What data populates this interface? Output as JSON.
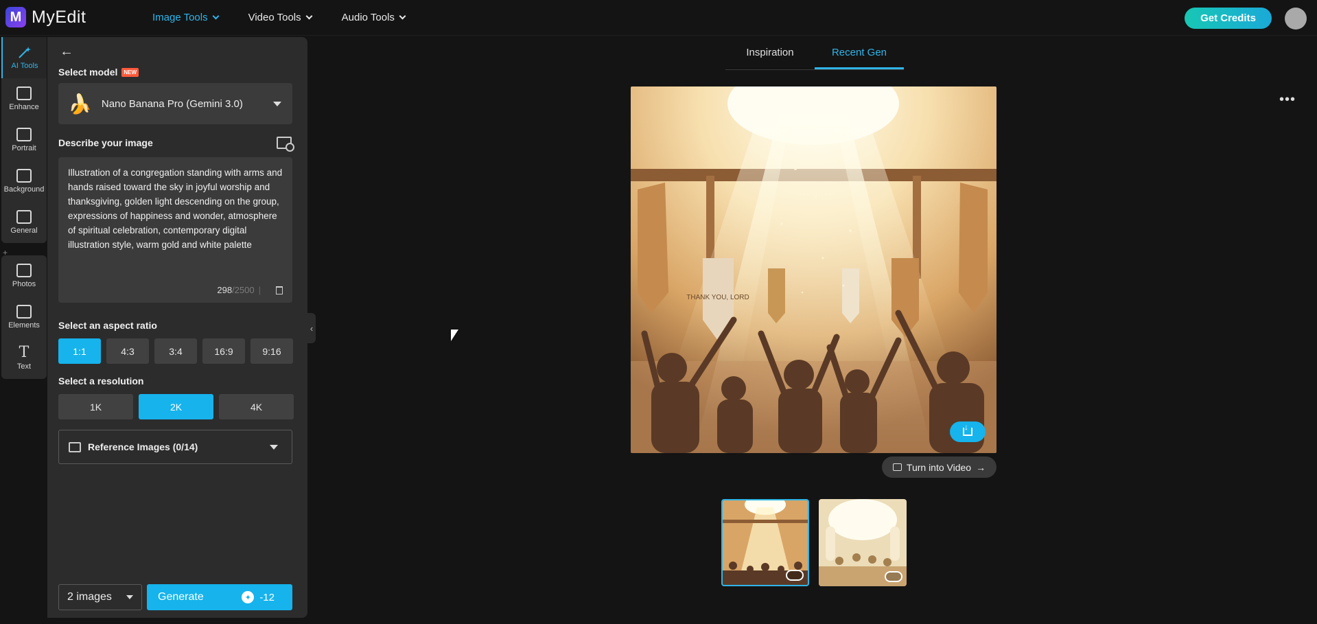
{
  "app": {
    "name": "MyEdit",
    "logo_letter": "M"
  },
  "topnav": [
    {
      "label": "Image Tools",
      "active": true
    },
    {
      "label": "Video Tools",
      "active": false
    },
    {
      "label": "Audio Tools",
      "active": false
    }
  ],
  "header": {
    "credits_label": "Get Credits"
  },
  "rail": {
    "group1": [
      {
        "label": "AI Tools",
        "icon": "wand-icon",
        "active": true
      },
      {
        "label": "Enhance",
        "icon": "enhance-icon"
      },
      {
        "label": "Portrait",
        "icon": "portrait-icon"
      },
      {
        "label": "Background",
        "icon": "background-icon"
      },
      {
        "label": "General",
        "icon": "general-icon"
      }
    ],
    "group2": [
      {
        "label": "Photos",
        "icon": "photos-icon"
      },
      {
        "label": "Elements",
        "icon": "elements-icon"
      },
      {
        "label": "Text",
        "icon": "text-icon"
      }
    ]
  },
  "panel": {
    "model_label": "Select model",
    "new_badge": "NEW",
    "model_value": "Nano Banana Pro (Gemini 3.0)",
    "model_emoji": "🍌",
    "describe_label": "Describe your image",
    "prompt": "Illustration of a congregation standing with arms and hands raised toward the sky in joyful worship and thanksgiving, golden light descending on the group, expressions of happiness and wonder, atmosphere of spiritual celebration, contemporary digital illustration style, warm gold and white palette",
    "char_count": "298",
    "char_max": "/2500",
    "char_sep": "|",
    "aspect_label": "Select an aspect ratio",
    "aspect_options": [
      "1:1",
      "4:3",
      "3:4",
      "16:9",
      "9:16"
    ],
    "aspect_selected": "1:1",
    "resolution_label": "Select a resolution",
    "resolution_options": [
      "1K",
      "2K",
      "4K"
    ],
    "resolution_selected": "2K",
    "reference_label": "Reference Images (0/14)",
    "count_value": "2 images",
    "generate_label": "Generate",
    "generate_cost": "-12"
  },
  "main": {
    "tabs": [
      {
        "label": "Inspiration",
        "active": false
      },
      {
        "label": "Recent Gen",
        "active": true
      }
    ],
    "turn_video_label": "Turn into Video",
    "turn_video_arrow": "→",
    "banner_text": "THANK YOU, LORD",
    "thumbnails": [
      {
        "selected": true
      },
      {
        "selected": false
      }
    ]
  },
  "colors": {
    "accent": "#16b3ec",
    "panel": "#2c2c2c",
    "background": "#141414",
    "credits_gradient": "#18c7b4"
  }
}
